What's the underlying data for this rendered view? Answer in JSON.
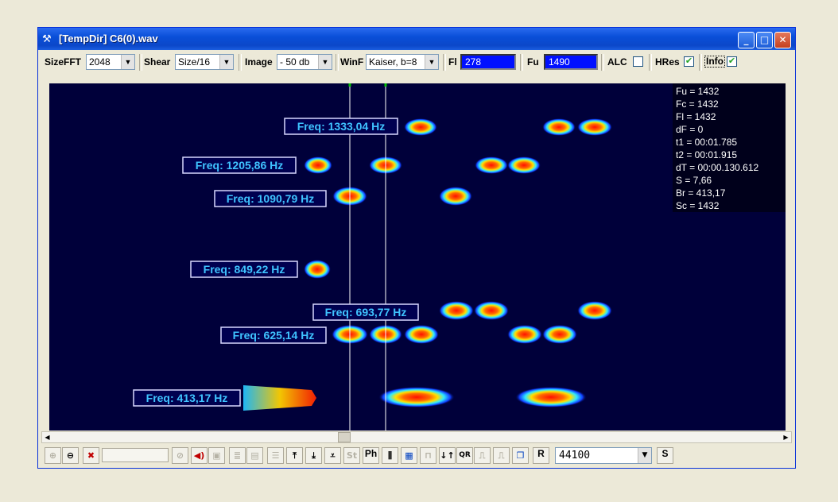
{
  "window": {
    "title": "[TempDir] С6(0).wav",
    "min": "_",
    "max": "□",
    "close": "✕"
  },
  "toolbar": {
    "sizefft_label": "SizeFFT",
    "sizefft_value": "2048",
    "shear_label": "Shear",
    "shear_value": "Size/16",
    "image_label": "Image",
    "image_value": "- 50 db",
    "winf_label": "WinF",
    "winf_value": "Kaiser, b=8",
    "fl_label": "Fl",
    "fl_value": "278",
    "fu_label": "Fu",
    "fu_value": "1490",
    "alc_label": "ALC",
    "hres_label": "HRes",
    "info_label": "Info"
  },
  "info_panel": [
    "Fu = 1432",
    "Fc = 1432",
    "Fl = 1432",
    "dF = 0",
    "t1 = 00:01.785",
    "t2 = 00:01.915",
    "dT = 00:00.130.612",
    "S = 7,66",
    "Br = 413,17",
    "Sc = 1432"
  ],
  "freq_labels": [
    "Freq: 1333,04 Hz",
    "Freq: 1205,86 Hz",
    "Freq: 1090,79 Hz",
    "Freq: 849,22 Hz",
    "Freq: 693,77 Hz",
    "Freq: 625,14 Hz",
    "Freq: 413,17 Hz"
  ],
  "bottom": {
    "ph_label": "Ph",
    "r_label": "R",
    "s_label": "S",
    "rate_value": "44100"
  },
  "colors": {
    "background": "#00003a",
    "label_text": "#3fc3ff",
    "titlebar": "#0a4fd8"
  }
}
